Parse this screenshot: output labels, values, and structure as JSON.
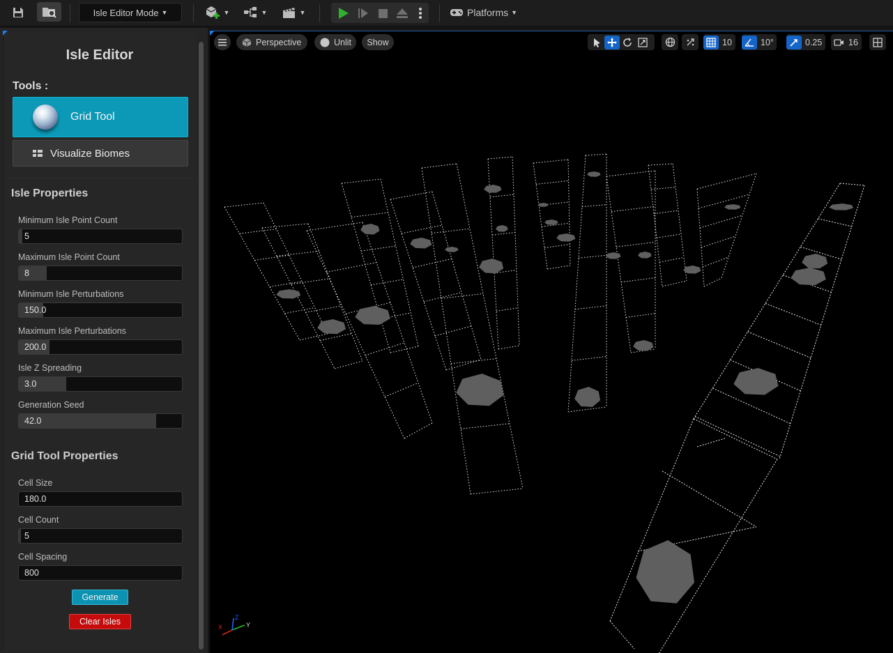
{
  "toolbar": {
    "mode_label": "Isle Editor Mode",
    "platforms_label": "Platforms",
    "icons": [
      "save-icon",
      "browse-content-icon",
      "add-actor-icon",
      "blueprint-icon",
      "cinematics-icon",
      "play-icon",
      "skip-frame-icon",
      "stop-icon",
      "eject-icon",
      "more-options-icon",
      "platforms-icon"
    ],
    "accent_color": "#2fb02f"
  },
  "panel": {
    "title": "Isle Editor",
    "tools_label": "Tools :",
    "grid_tool_label": "Grid Tool",
    "visualize_biomes_label": "Visualize Biomes",
    "isle_properties_title": "Isle Properties",
    "isle_properties": [
      {
        "label": "Minimum Isle Point Count",
        "value": "5",
        "fill": 0.02
      },
      {
        "label": "Maximum Isle Point Count",
        "value": "8",
        "fill": 0.17
      },
      {
        "label": "Minimum Isle Perturbations",
        "value": "150.0",
        "fill": 0.15
      },
      {
        "label": "Maximum Isle Perturbations",
        "value": "200.0",
        "fill": 0.19
      },
      {
        "label": "Isle Z Spreading",
        "value": "3.0",
        "fill": 0.29
      },
      {
        "label": "Generation Seed",
        "value": "42.0",
        "fill": 0.84
      }
    ],
    "grid_tool_properties_title": "Grid Tool Properties",
    "grid_tool_properties": [
      {
        "label": "Cell Size",
        "value": "180.0"
      },
      {
        "label": "Cell Count",
        "value": "5"
      },
      {
        "label": "Cell Spacing",
        "value": "800"
      }
    ],
    "generate_label": "Generate",
    "clear_isles_label": "Clear Isles",
    "accent_color": "#0b99b7",
    "danger_color": "#c50b0b"
  },
  "viewport": {
    "perspective_label": "Perspective",
    "lighting_label": "Unlit",
    "show_label": "Show",
    "grid_snap_value": "10",
    "rotation_snap_value": "10°",
    "scale_snap_value": "0.25",
    "camera_speed_value": "16",
    "axis_labels": {
      "x": "X",
      "y": "Y",
      "z": "Z"
    },
    "icons": [
      "hamburger-menu-icon",
      "perspective-cube-icon",
      "unlit-sphere-icon",
      "select-icon",
      "translate-icon",
      "rotate-icon",
      "scale-icon",
      "world-space-icon",
      "surface-snap-icon",
      "grid-snap-icon",
      "rotation-snap-icon",
      "scale-snap-icon",
      "camera-speed-icon",
      "layout-icon"
    ]
  }
}
